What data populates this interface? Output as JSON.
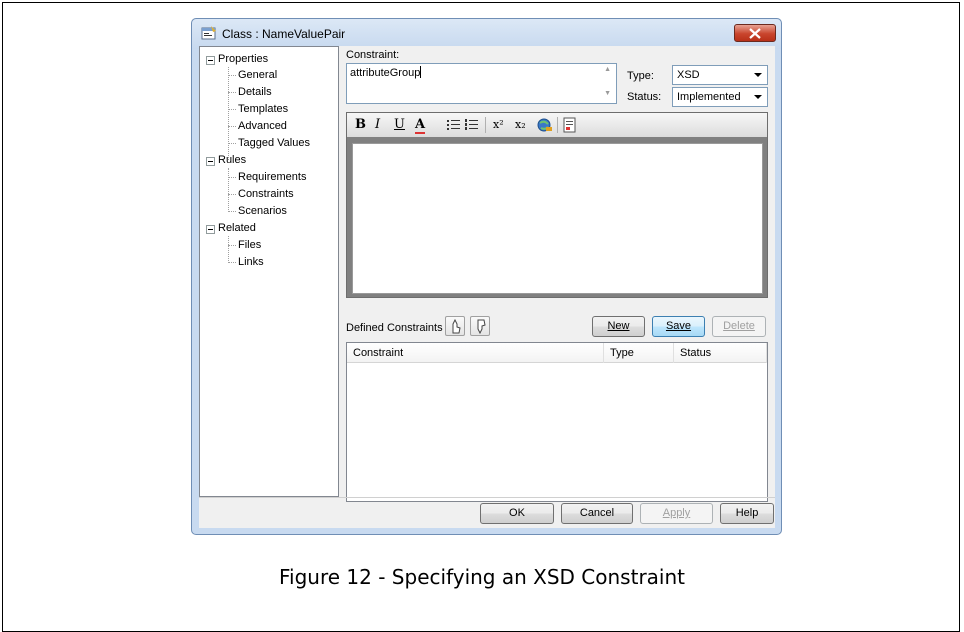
{
  "dialog": {
    "title": "Class : NameValuePair",
    "close_icon": "close-icon"
  },
  "tree": {
    "groups": [
      {
        "label": "Properties",
        "children": [
          "General",
          "Details",
          "Templates",
          "Advanced",
          "Tagged Values"
        ]
      },
      {
        "label": "Rules",
        "children": [
          "Requirements",
          "Constraints",
          "Scenarios"
        ]
      },
      {
        "label": "Related",
        "children": [
          "Files",
          "Links"
        ]
      }
    ]
  },
  "form": {
    "constraint_label": "Constraint:",
    "constraint_value": "attributeGroup",
    "type_label": "Type:",
    "type_value": "XSD",
    "status_label": "Status:",
    "status_value": "Implemented"
  },
  "toolbar": {
    "bold": "B",
    "italic": "I",
    "underline": "U",
    "font_color": "A",
    "bullet_list": "bullet-list-icon",
    "number_list": "numbered-list-icon",
    "superscript": "x²",
    "subscript": "x₂",
    "hyperlink": "hyperlink-icon",
    "document": "document-icon"
  },
  "defined": {
    "label": "Defined Constraints",
    "new_label": "New",
    "save_label": "Save",
    "delete_label": "Delete",
    "columns": [
      "Constraint",
      "Type",
      "Status"
    ],
    "rows": []
  },
  "footer": {
    "ok_label": "OK",
    "cancel_label": "Cancel",
    "apply_label": "Apply",
    "help_label": "Help"
  },
  "caption": "Figure 12 - Specifying an XSD Constraint",
  "colors": {
    "window_frame": "#c8daf0",
    "close_button": "#c9452d",
    "default_button": "#a7d9f5"
  }
}
